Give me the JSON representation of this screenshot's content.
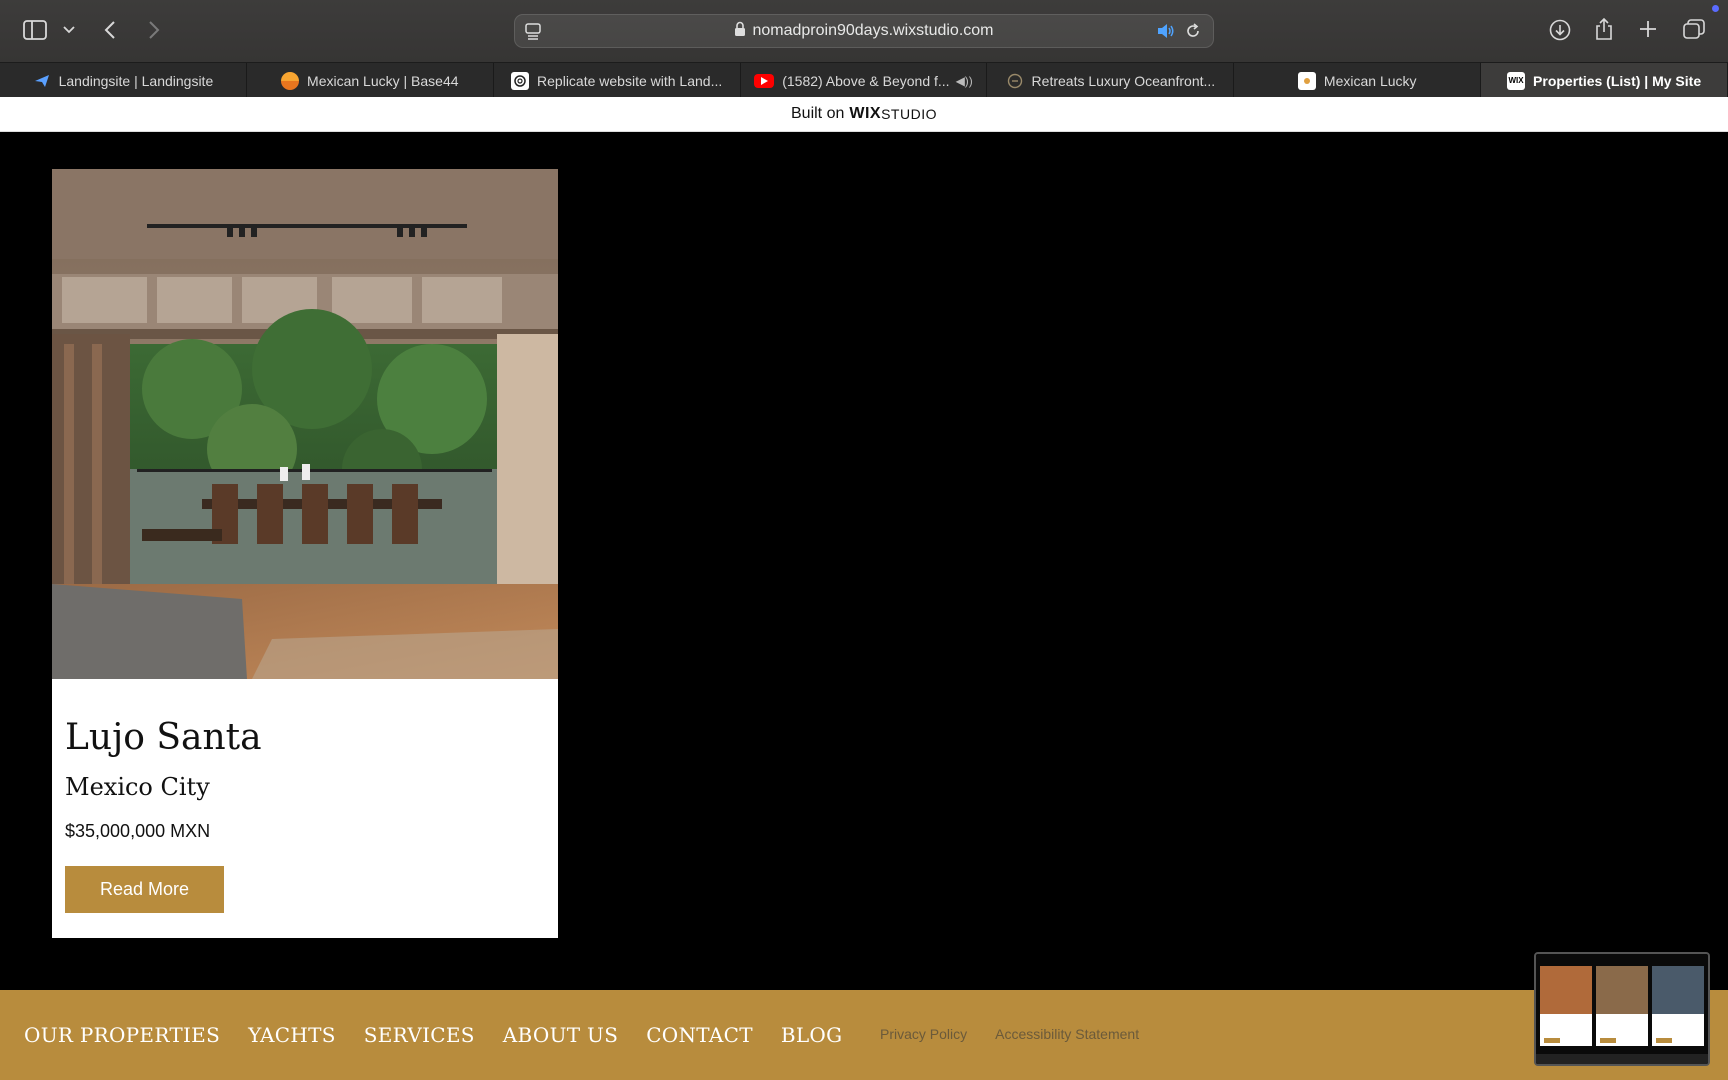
{
  "browser": {
    "url": "nomadproin90days.wixstudio.com",
    "tabs": [
      {
        "label": "Landingsite | Landingsite",
        "icon": "paper-plane-icon"
      },
      {
        "label": "Mexican Lucky | Base44",
        "icon": "sunset-icon"
      },
      {
        "label": "Replicate website with Land...",
        "icon": "openai-icon"
      },
      {
        "label": "(1582) Above & Beyond f...",
        "icon": "youtube-icon"
      },
      {
        "label": "Retreats Luxury Oceanfront...",
        "icon": "circle-logo-icon"
      },
      {
        "label": "Mexican Lucky",
        "icon": "site-icon"
      },
      {
        "label": "Properties (List) | My Site",
        "icon": "wix-icon",
        "active": true
      }
    ]
  },
  "wix_banner": {
    "prefix": "Built on",
    "brand": "WIX",
    "suffix": "STUDIO"
  },
  "property": {
    "title": "Lujo Santa",
    "location": "Mexico City",
    "price": "$35,000,000 MXN",
    "button": "Read More"
  },
  "footer": {
    "nav": [
      "OUR PROPERTIES",
      "YACHTS",
      "SERVICES",
      "ABOUT US",
      "CONTACT",
      "BLOG"
    ],
    "links": [
      "Privacy Policy",
      "Accessibility Statement"
    ]
  },
  "colors": {
    "accent": "#b88c3d",
    "page_bg": "#000000",
    "card_bg": "#ffffff"
  }
}
